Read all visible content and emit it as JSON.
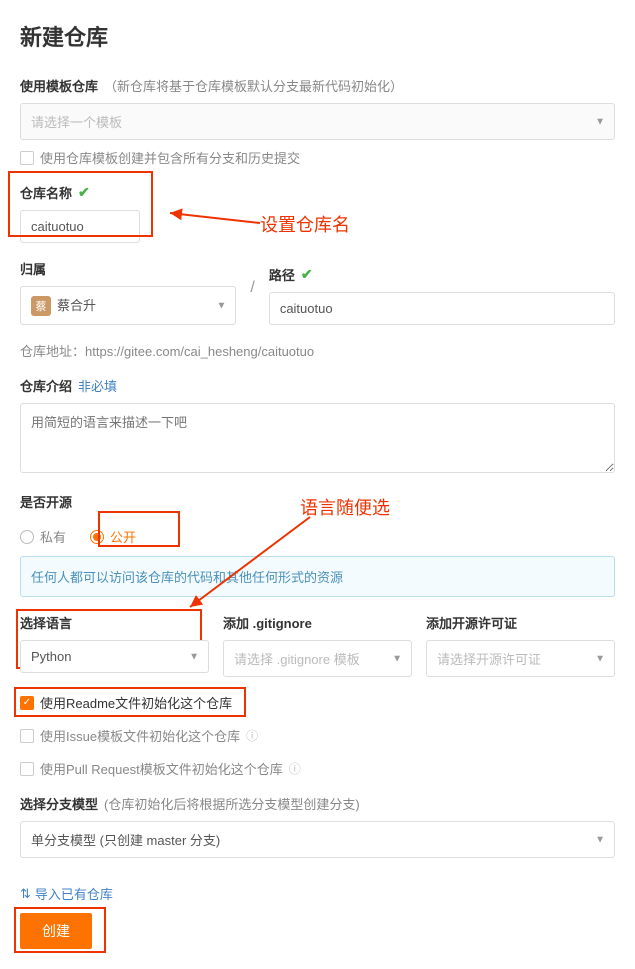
{
  "page_title": "新建仓库",
  "template": {
    "label": "使用模板仓库",
    "note": "（新仓库将基于仓库模板默认分支最新代码初始化）",
    "placeholder": "请选择一个模板",
    "include_all_label": "使用仓库模板创建并包含所有分支和历史提交"
  },
  "repo_name": {
    "label": "仓库名称",
    "value": "caituotuo",
    "annotation": "设置仓库名"
  },
  "owner": {
    "label": "归属",
    "badge": "蔡",
    "value": "蔡合升"
  },
  "path": {
    "label": "路径",
    "value": "caituotuo"
  },
  "repo_url": {
    "label": "仓库地址：",
    "value": "https://gitee.com/cai_hesheng/caituotuo"
  },
  "description": {
    "label": "仓库介绍",
    "optional": "非必填",
    "placeholder": "用简短的语言来描述一下吧"
  },
  "open_source": {
    "label": "是否开源",
    "private": "私有",
    "public": "公开",
    "banner": "任何人都可以访问该仓库的代码和其他任何形式的资源",
    "annotation": "语言随便选"
  },
  "language": {
    "label": "选择语言",
    "value": "Python"
  },
  "gitignore": {
    "label": "添加 .gitignore",
    "placeholder": "请选择 .gitignore 模板"
  },
  "license": {
    "label": "添加开源许可证",
    "placeholder": "请选择开源许可证"
  },
  "init_options": {
    "readme": "使用Readme文件初始化这个仓库",
    "issue": "使用Issue模板文件初始化这个仓库",
    "pr": "使用Pull Request模板文件初始化这个仓库"
  },
  "branch_model": {
    "label": "选择分支模型",
    "note": "(仓库初始化后将根据所选分支模型创建分支)",
    "value": "单分支模型 (只创建 master 分支)"
  },
  "import_link": "导入已有仓库",
  "create_button": "创建"
}
